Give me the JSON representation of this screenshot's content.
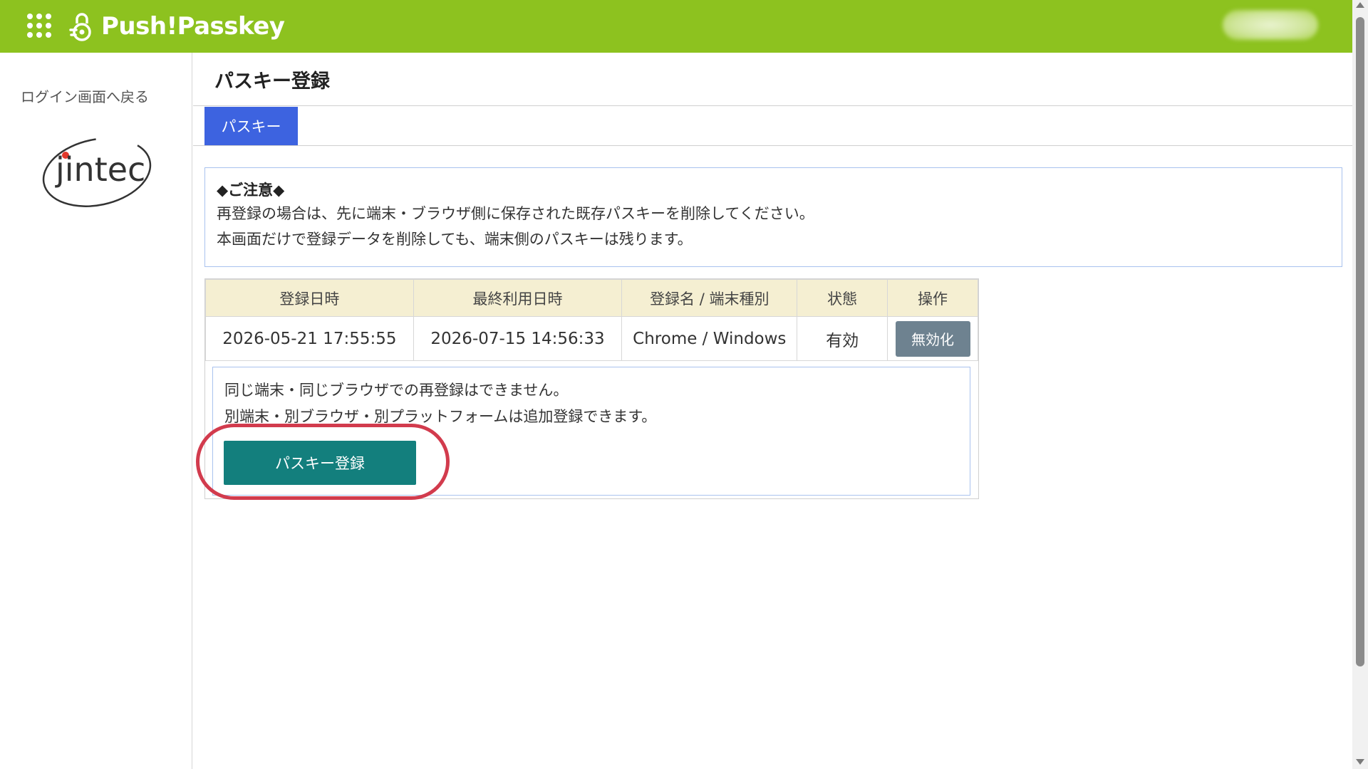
{
  "header": {
    "brand": "Push!Passkey",
    "apps_icon": "apps-grid-icon",
    "brand_icon": "passkey-lock-icon",
    "accent_color": "#8dc21f"
  },
  "sidebar": {
    "back_link": "ログイン画面へ戻る",
    "logo_text": "jintec"
  },
  "main": {
    "title": "パスキー登録",
    "tabs": [
      {
        "label": "パスキー",
        "active": true
      }
    ],
    "notice": {
      "title": "◆ご注意◆",
      "lines": [
        "再登録の場合は、先に端末・ブラウザ側に保存された既存パスキーを削除してください。",
        "本画面だけで登録データを削除しても、端末側のパスキーは残ります。"
      ]
    },
    "table": {
      "headers": [
        "登録日時",
        "最終利用日時",
        "登録名 / 端末種別",
        "状態",
        "操作"
      ],
      "rows": [
        {
          "registered": "2026-05-21 17:55:55",
          "last_used": "2026-07-15 14:56:33",
          "name_device": "Chrome / Windows",
          "status": "有効",
          "action": "無効化"
        }
      ]
    },
    "info": {
      "lines": [
        "同じ端末・同じブラウザでの再登録はできません。",
        "別端末・別ブラウザ・別プラットフォームは追加登録できます。"
      ],
      "register_button": "パスキー登録"
    }
  },
  "colors": {
    "tab_active": "#3d63e0",
    "register_button": "#137f7d",
    "disable_button": "#6e8290",
    "highlight": "#d23b4d",
    "table_header_bg": "#f5efd2"
  }
}
